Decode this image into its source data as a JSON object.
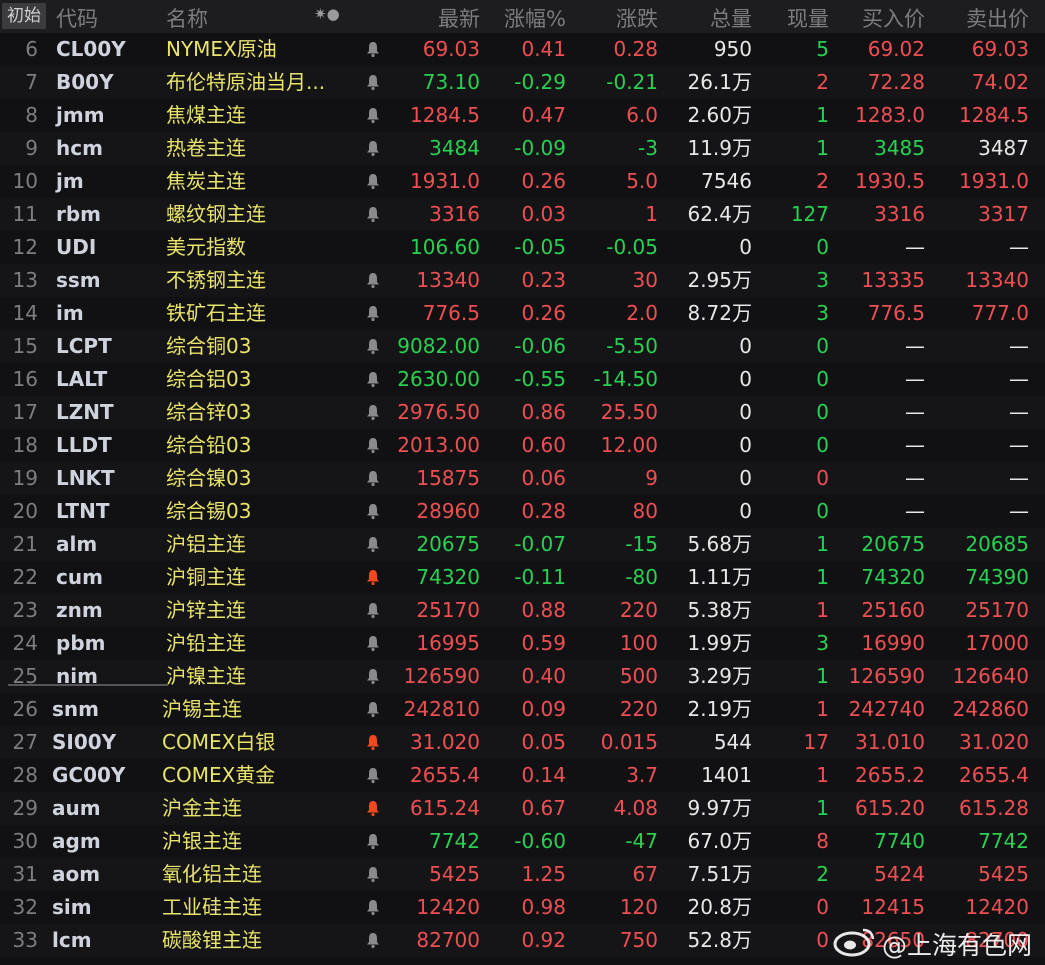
{
  "header": {
    "reset_label": "初始",
    "columns": [
      "代码",
      "名称",
      "最新",
      "涨幅%",
      "涨跌",
      "总量",
      "现量",
      "买入价",
      "卖出价"
    ],
    "icons_label": "✷●"
  },
  "rows": [
    {
      "idx": "6",
      "code": "CL00Y",
      "name": "NYMEX原油",
      "bell": "gray",
      "last": "69.03",
      "pct": "0.41",
      "chg": "0.28",
      "vol": "950",
      "cur": "5",
      "bid": "69.02",
      "ask": "69.03",
      "dir": "red",
      "cur_col": "green",
      "bid_col": "red",
      "ask_col": "red"
    },
    {
      "idx": "7",
      "code": "B00Y",
      "name": "布伦特原油当月...",
      "bell": "gray",
      "last": "73.10",
      "pct": "-0.29",
      "chg": "-0.21",
      "vol": "26.1万",
      "cur": "2",
      "bid": "72.28",
      "ask": "74.02",
      "dir": "green",
      "cur_col": "red",
      "bid_col": "red",
      "ask_col": "red"
    },
    {
      "idx": "8",
      "code": "jmm",
      "name": "焦煤主连",
      "bell": "gray",
      "last": "1284.5",
      "pct": "0.47",
      "chg": "6.0",
      "vol": "2.60万",
      "cur": "1",
      "bid": "1283.0",
      "ask": "1284.5",
      "dir": "red",
      "cur_col": "green",
      "bid_col": "red",
      "ask_col": "red"
    },
    {
      "idx": "9",
      "code": "hcm",
      "name": "热卷主连",
      "bell": "gray",
      "last": "3484",
      "pct": "-0.09",
      "chg": "-3",
      "vol": "11.9万",
      "cur": "1",
      "bid": "3485",
      "ask": "3487",
      "dir": "green",
      "cur_col": "green",
      "bid_col": "green",
      "ask_col": "white"
    },
    {
      "idx": "10",
      "code": "jm",
      "name": "焦炭主连",
      "bell": "gray",
      "last": "1931.0",
      "pct": "0.26",
      "chg": "5.0",
      "vol": "7546",
      "cur": "2",
      "bid": "1930.5",
      "ask": "1931.0",
      "dir": "red",
      "cur_col": "red",
      "bid_col": "red",
      "ask_col": "red"
    },
    {
      "idx": "11",
      "code": "rbm",
      "name": "螺纹钢主连",
      "bell": "gray",
      "last": "3316",
      "pct": "0.03",
      "chg": "1",
      "vol": "62.4万",
      "cur": "127",
      "bid": "3316",
      "ask": "3317",
      "dir": "red",
      "cur_col": "green",
      "bid_col": "red",
      "ask_col": "red"
    },
    {
      "idx": "12",
      "code": "UDI",
      "name": "美元指数",
      "bell": "none",
      "last": "106.60",
      "pct": "-0.05",
      "chg": "-0.05",
      "vol": "0",
      "cur": "0",
      "bid": "—",
      "ask": "—",
      "dir": "green",
      "cur_col": "green",
      "bid_col": "white",
      "ask_col": "white"
    },
    {
      "idx": "13",
      "code": "ssm",
      "name": "不锈钢主连",
      "bell": "gray",
      "last": "13340",
      "pct": "0.23",
      "chg": "30",
      "vol": "2.95万",
      "cur": "3",
      "bid": "13335",
      "ask": "13340",
      "dir": "red",
      "cur_col": "green",
      "bid_col": "red",
      "ask_col": "red"
    },
    {
      "idx": "14",
      "code": "im",
      "name": "铁矿石主连",
      "bell": "gray",
      "last": "776.5",
      "pct": "0.26",
      "chg": "2.0",
      "vol": "8.72万",
      "cur": "3",
      "bid": "776.5",
      "ask": "777.0",
      "dir": "red",
      "cur_col": "green",
      "bid_col": "red",
      "ask_col": "red"
    },
    {
      "idx": "15",
      "code": "LCPT",
      "name": "综合铜03",
      "bell": "gray",
      "last": "9082.00",
      "pct": "-0.06",
      "chg": "-5.50",
      "vol": "0",
      "cur": "0",
      "bid": "—",
      "ask": "—",
      "dir": "green",
      "cur_col": "green",
      "bid_col": "white",
      "ask_col": "white"
    },
    {
      "idx": "16",
      "code": "LALT",
      "name": "综合铝03",
      "bell": "gray",
      "last": "2630.00",
      "pct": "-0.55",
      "chg": "-14.50",
      "vol": "0",
      "cur": "0",
      "bid": "—",
      "ask": "—",
      "dir": "green",
      "cur_col": "green",
      "bid_col": "white",
      "ask_col": "white"
    },
    {
      "idx": "17",
      "code": "LZNT",
      "name": "综合锌03",
      "bell": "gray",
      "last": "2976.50",
      "pct": "0.86",
      "chg": "25.50",
      "vol": "0",
      "cur": "0",
      "bid": "—",
      "ask": "—",
      "dir": "red",
      "cur_col": "green",
      "bid_col": "white",
      "ask_col": "white"
    },
    {
      "idx": "18",
      "code": "LLDT",
      "name": "综合铅03",
      "bell": "gray",
      "last": "2013.00",
      "pct": "0.60",
      "chg": "12.00",
      "vol": "0",
      "cur": "0",
      "bid": "—",
      "ask": "—",
      "dir": "red",
      "cur_col": "green",
      "bid_col": "white",
      "ask_col": "white"
    },
    {
      "idx": "19",
      "code": "LNKT",
      "name": "综合镍03",
      "bell": "gray",
      "last": "15875",
      "pct": "0.06",
      "chg": "9",
      "vol": "0",
      "cur": "0",
      "bid": "—",
      "ask": "—",
      "dir": "red",
      "cur_col": "red",
      "bid_col": "white",
      "ask_col": "white"
    },
    {
      "idx": "20",
      "code": "LTNT",
      "name": "综合锡03",
      "bell": "gray",
      "last": "28960",
      "pct": "0.28",
      "chg": "80",
      "vol": "0",
      "cur": "0",
      "bid": "—",
      "ask": "—",
      "dir": "red",
      "cur_col": "green",
      "bid_col": "white",
      "ask_col": "white"
    },
    {
      "idx": "21",
      "code": "alm",
      "name": "沪铝主连",
      "bell": "gray",
      "last": "20675",
      "pct": "-0.07",
      "chg": "-15",
      "vol": "5.68万",
      "cur": "1",
      "bid": "20675",
      "ask": "20685",
      "dir": "green",
      "cur_col": "green",
      "bid_col": "green",
      "ask_col": "green"
    },
    {
      "idx": "22",
      "code": "cum",
      "name": "沪铜主连",
      "bell": "red",
      "last": "74320",
      "pct": "-0.11",
      "chg": "-80",
      "vol": "1.11万",
      "cur": "1",
      "bid": "74320",
      "ask": "74390",
      "dir": "green",
      "cur_col": "green",
      "bid_col": "green",
      "ask_col": "green"
    },
    {
      "idx": "23",
      "code": "znm",
      "name": "沪锌主连",
      "bell": "gray",
      "last": "25170",
      "pct": "0.88",
      "chg": "220",
      "vol": "5.38万",
      "cur": "1",
      "bid": "25160",
      "ask": "25170",
      "dir": "red",
      "cur_col": "red",
      "bid_col": "red",
      "ask_col": "red"
    },
    {
      "idx": "24",
      "code": "pbm",
      "name": "沪铅主连",
      "bell": "gray",
      "last": "16995",
      "pct": "0.59",
      "chg": "100",
      "vol": "1.99万",
      "cur": "3",
      "bid": "16990",
      "ask": "17000",
      "dir": "red",
      "cur_col": "green",
      "bid_col": "red",
      "ask_col": "red"
    },
    {
      "idx": "25",
      "code": "nim",
      "name": "沪镍主连",
      "bell": "gray",
      "last": "126590",
      "pct": "0.40",
      "chg": "500",
      "vol": "3.29万",
      "cur": "1",
      "bid": "126590",
      "ask": "126640",
      "dir": "red",
      "cur_col": "green",
      "bid_col": "red",
      "ask_col": "red"
    },
    {
      "idx": "26",
      "code": "snm",
      "name": "沪锡主连",
      "bell": "gray",
      "last": "242810",
      "pct": "0.09",
      "chg": "220",
      "vol": "2.19万",
      "cur": "1",
      "bid": "242740",
      "ask": "242860",
      "dir": "red",
      "cur_col": "red",
      "bid_col": "red",
      "ask_col": "red"
    },
    {
      "idx": "27",
      "code": "SI00Y",
      "name": "COMEX白银",
      "bell": "red",
      "last": "31.020",
      "pct": "0.05",
      "chg": "0.015",
      "vol": "544",
      "cur": "17",
      "bid": "31.010",
      "ask": "31.020",
      "dir": "red",
      "cur_col": "red",
      "bid_col": "red",
      "ask_col": "red"
    },
    {
      "idx": "28",
      "code": "GC00Y",
      "name": "COMEX黄金",
      "bell": "gray",
      "last": "2655.4",
      "pct": "0.14",
      "chg": "3.7",
      "vol": "1401",
      "cur": "1",
      "bid": "2655.2",
      "ask": "2655.4",
      "dir": "red",
      "cur_col": "red",
      "bid_col": "red",
      "ask_col": "red"
    },
    {
      "idx": "29",
      "code": "aum",
      "name": "沪金主连",
      "bell": "red",
      "last": "615.24",
      "pct": "0.67",
      "chg": "4.08",
      "vol": "9.97万",
      "cur": "1",
      "bid": "615.20",
      "ask": "615.28",
      "dir": "red",
      "cur_col": "green",
      "bid_col": "red",
      "ask_col": "red"
    },
    {
      "idx": "30",
      "code": "agm",
      "name": "沪银主连",
      "bell": "gray",
      "last": "7742",
      "pct": "-0.60",
      "chg": "-47",
      "vol": "67.0万",
      "cur": "8",
      "bid": "7740",
      "ask": "7742",
      "dir": "green",
      "cur_col": "red",
      "bid_col": "green",
      "ask_col": "green"
    },
    {
      "idx": "31",
      "code": "aom",
      "name": "氧化铝主连",
      "bell": "gray",
      "last": "5425",
      "pct": "1.25",
      "chg": "67",
      "vol": "7.51万",
      "cur": "2",
      "bid": "5424",
      "ask": "5425",
      "dir": "red",
      "cur_col": "green",
      "bid_col": "red",
      "ask_col": "red"
    },
    {
      "idx": "32",
      "code": "sim",
      "name": "工业硅主连",
      "bell": "gray",
      "last": "12420",
      "pct": "0.98",
      "chg": "120",
      "vol": "20.8万",
      "cur": "0",
      "bid": "12415",
      "ask": "12420",
      "dir": "red",
      "cur_col": "red",
      "bid_col": "red",
      "ask_col": "red"
    },
    {
      "idx": "33",
      "code": "lcm",
      "name": "碳酸锂主连",
      "bell": "gray",
      "last": "82700",
      "pct": "0.92",
      "chg": "750",
      "vol": "52.8万",
      "cur": "0",
      "bid": "82650",
      "ask": "82700",
      "dir": "red",
      "cur_col": "red",
      "bid_col": "red",
      "ask_col": "red"
    }
  ],
  "watermark": {
    "text": "@上海有色网"
  },
  "colors": {
    "up": "#ee4f53",
    "down": "#28d152",
    "name": "#e8e36a",
    "bell_red": "#f0491f",
    "bell_gray": "#8a8a8e"
  }
}
